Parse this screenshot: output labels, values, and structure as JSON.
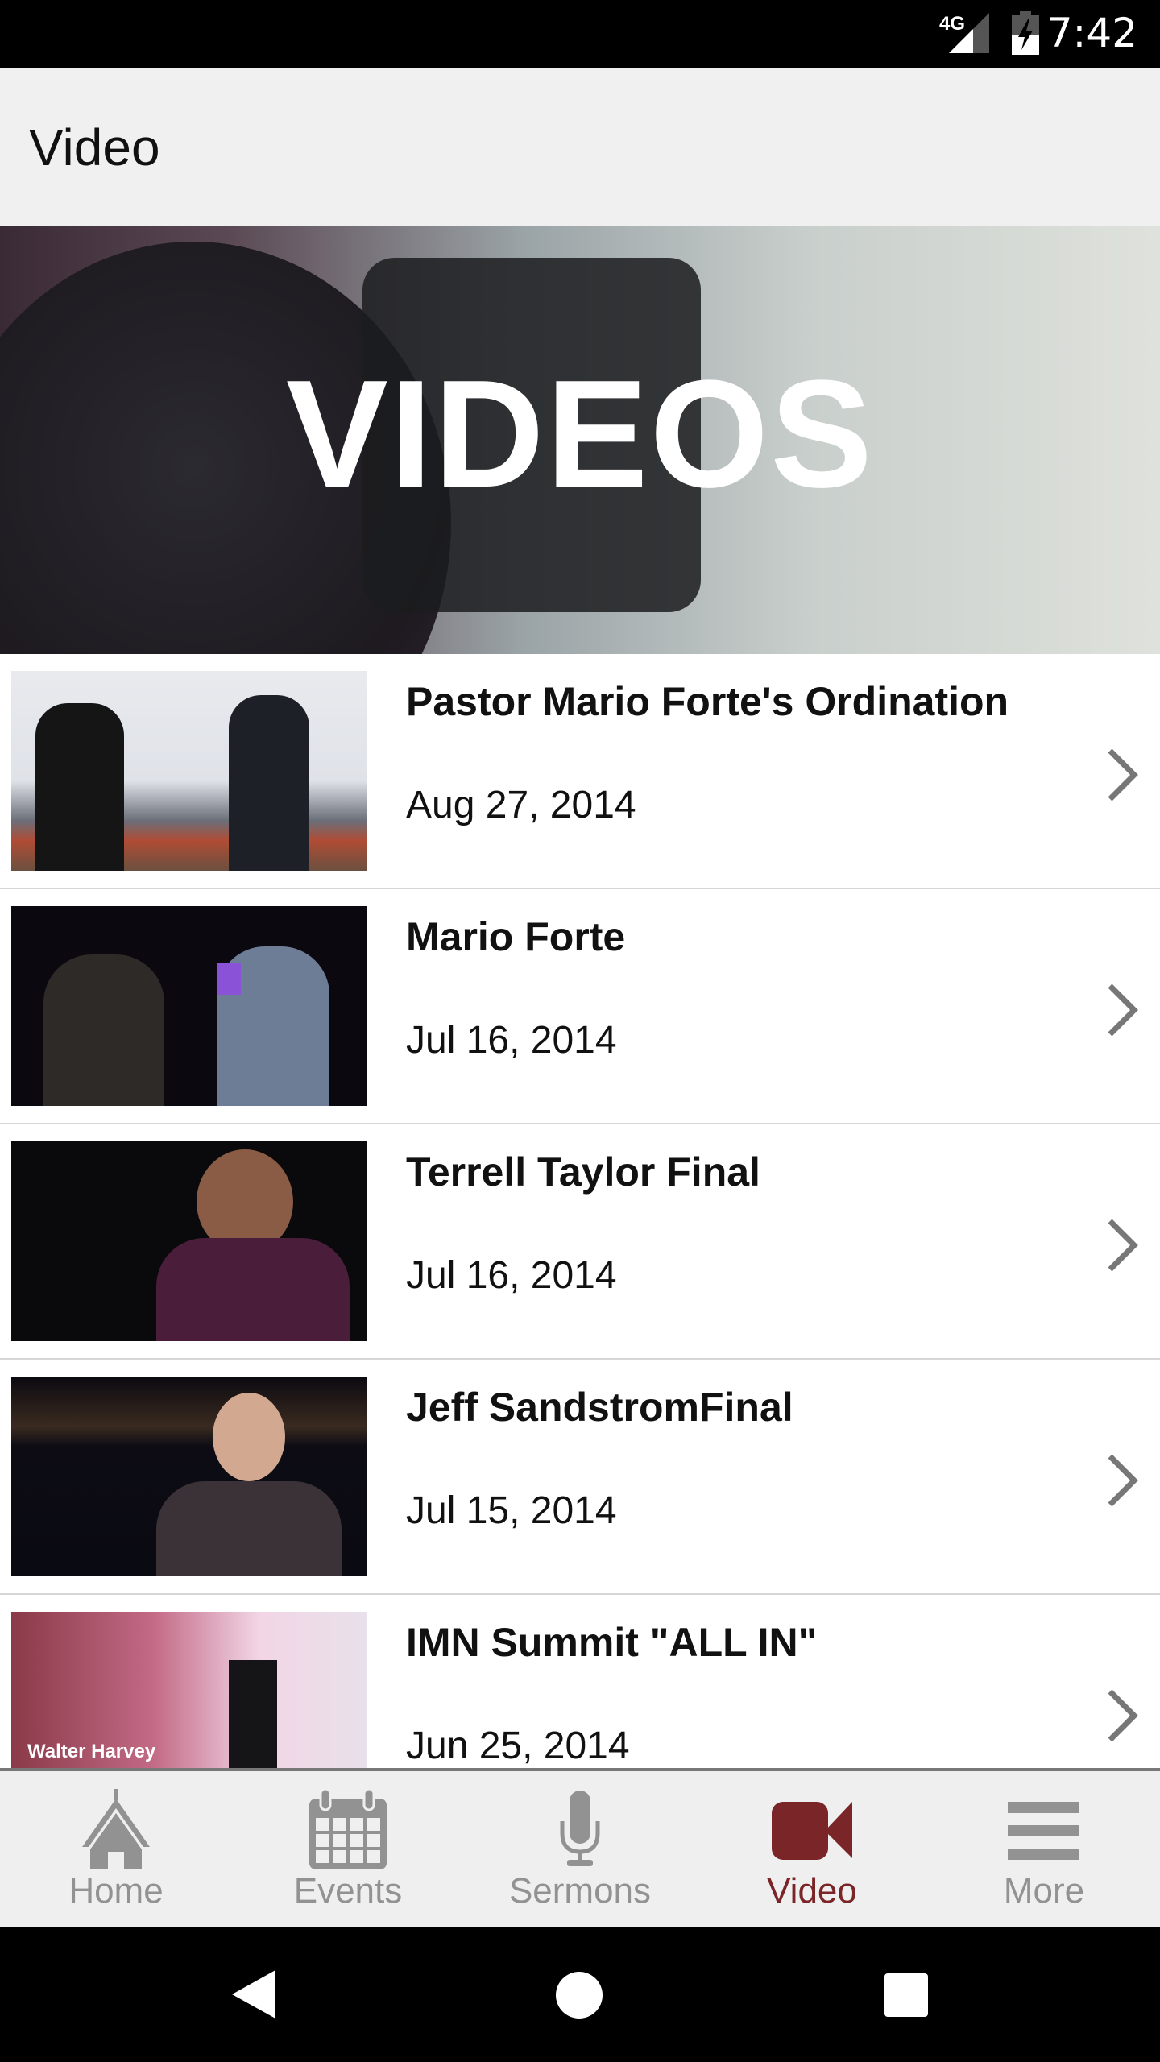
{
  "status_bar": {
    "network": "4G",
    "time": "7:42"
  },
  "app_bar": {
    "title": "Video"
  },
  "banner": {
    "text": "VIDEOS"
  },
  "videos": [
    {
      "title": "Pastor Mario Forte's Ordination",
      "date": "Aug 27, 2014"
    },
    {
      "title": "Mario Forte",
      "date": "Jul 16, 2014"
    },
    {
      "title": "Terrell Taylor Final",
      "date": "Jul 16, 2014"
    },
    {
      "title": "Jeff SandstromFinal",
      "date": "Jul 15, 2014"
    },
    {
      "title": "IMN Summit \"ALL IN\"",
      "date": "Jun 25, 2014",
      "thumb_caption": "Walter Harvey"
    }
  ],
  "bottom_nav": {
    "items": [
      {
        "label": "Home",
        "icon": "church-icon"
      },
      {
        "label": "Events",
        "icon": "calendar-icon"
      },
      {
        "label": "Sermons",
        "icon": "microphone-icon"
      },
      {
        "label": "Video",
        "icon": "video-camera-icon",
        "active": true
      },
      {
        "label": "More",
        "icon": "menu-icon"
      }
    ]
  },
  "colors": {
    "accent": "#7a2528",
    "inactive": "#929292"
  }
}
